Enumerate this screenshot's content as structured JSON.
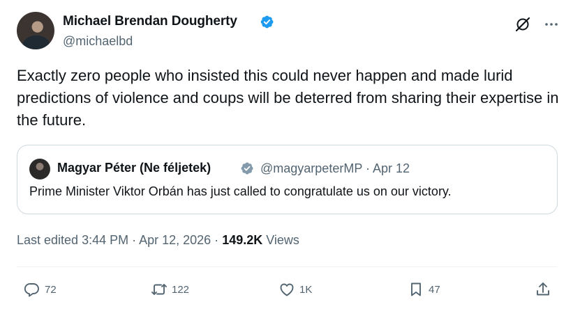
{
  "author": {
    "name": "Michael Brendan Dougherty",
    "handle": "@michaelbd",
    "verified": true
  },
  "tweet": {
    "text": "Exactly zero people who insisted this could never happen and made lurid predictions of violence and coups will be deterred from sharing their expertise in the future."
  },
  "quoted_tweet": {
    "name": "Magyar Péter (Ne féljetek)",
    "handle_date": "@magyarpeterMP · Apr 12",
    "text": "Prime Minister Viktor Orbán has just called to congratulate us on our victory."
  },
  "meta": {
    "edited": "Last edited 3:44 PM · Apr 12, 2026 · ",
    "views_count": "149.2K",
    "views_label": " Views"
  },
  "actions": {
    "replies": "72",
    "reposts": "122",
    "likes": "1K",
    "bookmarks": "47"
  },
  "colors": {
    "verified": "#1d9bf0",
    "quote_verified": "#829aab",
    "secondary_text": "#536471"
  },
  "icons": [
    "grok-icon",
    "more-icon",
    "reply-icon",
    "repost-icon",
    "like-icon",
    "bookmark-icon",
    "share-icon"
  ]
}
